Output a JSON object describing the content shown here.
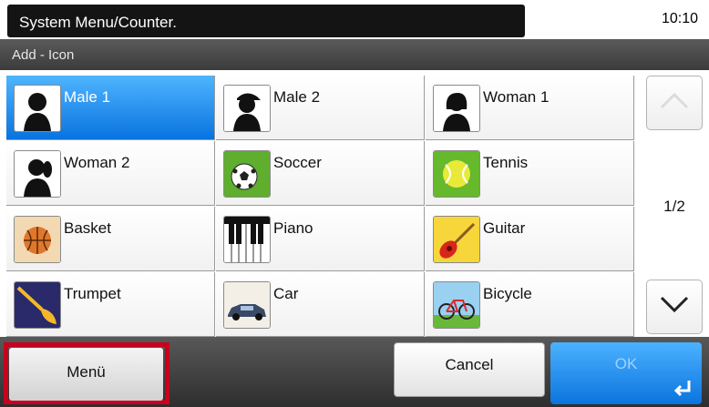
{
  "header": {
    "title": "System Menu/Counter.",
    "time": "10:10"
  },
  "subheader": {
    "title": "Add - Icon"
  },
  "icons": [
    {
      "label": "Male 1",
      "icon": "male-silhouette-icon",
      "selected": true
    },
    {
      "label": "Male 2",
      "icon": "male-cap-silhouette-icon",
      "selected": false
    },
    {
      "label": "Woman 1",
      "icon": "woman-silhouette-icon",
      "selected": false
    },
    {
      "label": "Woman 2",
      "icon": "woman-ponytail-silhouette-icon",
      "selected": false
    },
    {
      "label": "Soccer",
      "icon": "soccer-ball-icon",
      "selected": false
    },
    {
      "label": "Tennis",
      "icon": "tennis-ball-icon",
      "selected": false
    },
    {
      "label": "Basket",
      "icon": "basketball-icon",
      "selected": false
    },
    {
      "label": "Piano",
      "icon": "piano-keys-icon",
      "selected": false
    },
    {
      "label": "Guitar",
      "icon": "guitar-icon",
      "selected": false
    },
    {
      "label": "Trumpet",
      "icon": "trumpet-icon",
      "selected": false
    },
    {
      "label": "Car",
      "icon": "car-icon",
      "selected": false
    },
    {
      "label": "Bicycle",
      "icon": "bicycle-icon",
      "selected": false
    }
  ],
  "pagination": {
    "indicator": "1/2",
    "up_icon": "chevron-up-icon",
    "down_icon": "chevron-down-icon"
  },
  "footer": {
    "menu_label": "Menü",
    "cancel_label": "Cancel",
    "ok_label": "OK",
    "ok_icon": "enter-icon"
  },
  "colors": {
    "selected": "#0a7ce8",
    "highlight_border": "#c8001e",
    "ok_button": "#1a8cf0"
  }
}
